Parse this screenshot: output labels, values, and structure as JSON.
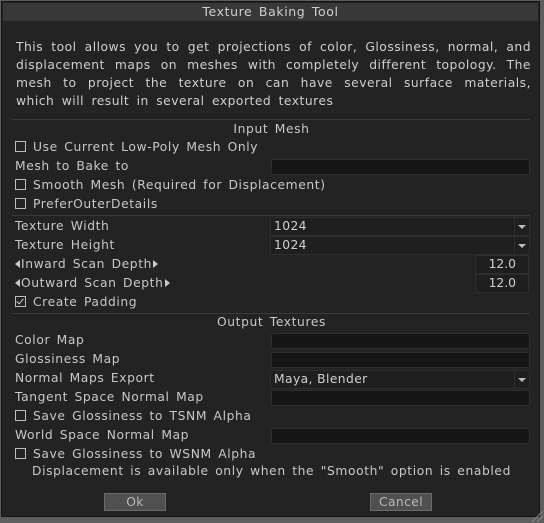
{
  "window": {
    "title": "Texture Baking Tool"
  },
  "description": "This tool allows you to get projections of color, Glossiness, normal, and displacement maps on meshes with completely different topology. The mesh to project the texture on can have several surface materials, which will result in several exported textures",
  "input_mesh": {
    "title": "Input Mesh",
    "use_current_low_poly": {
      "label": "Use Current Low-Poly Mesh Only",
      "checked": false
    },
    "mesh_to_bake_to": {
      "label": "Mesh to Bake to",
      "value": ""
    },
    "smooth_mesh": {
      "label": "Smooth Mesh (Required for Displacement)",
      "checked": false
    },
    "prefer_outer_details": {
      "label": "PreferOuterDetails",
      "checked": false
    }
  },
  "settings": {
    "texture_width": {
      "label": "Texture Width",
      "value": "1024"
    },
    "texture_height": {
      "label": "Texture Height",
      "value": "1024"
    },
    "inward_scan_depth": {
      "label": "Inward Scan Depth",
      "value": "12.0"
    },
    "outward_scan_depth": {
      "label": "Outward Scan Depth",
      "value": "12.0"
    },
    "create_padding": {
      "label": "Create Padding",
      "checked": true
    }
  },
  "output_textures": {
    "title": "Output Textures",
    "color_map": {
      "label": "Color Map",
      "value": ""
    },
    "glossiness_map": {
      "label": "Glossiness Map",
      "value": ""
    },
    "normal_maps_export": {
      "label": "Normal Maps Export",
      "value": "Maya, Blender"
    },
    "tangent_space_normal_map": {
      "label": "Tangent Space Normal Map",
      "value": ""
    },
    "save_gloss_tsnm": {
      "label": "Save Glossiness to TSNM Alpha",
      "checked": false
    },
    "world_space_normal_map": {
      "label": "World Space Normal Map",
      "value": ""
    },
    "save_gloss_wsnm": {
      "label": "Save Glossiness to WSNM Alpha",
      "checked": false
    }
  },
  "note": "Displacement is available only when the \"Smooth\" option is enabled",
  "buttons": {
    "ok": "Ok",
    "cancel": "Cancel"
  },
  "icons": {
    "checkbox": "checkbox-icon",
    "dropdown": "chevron-down-icon",
    "slider_left": "arrow-left-icon",
    "slider_right": "arrow-right-icon",
    "resize": "resize-grip-icon"
  }
}
